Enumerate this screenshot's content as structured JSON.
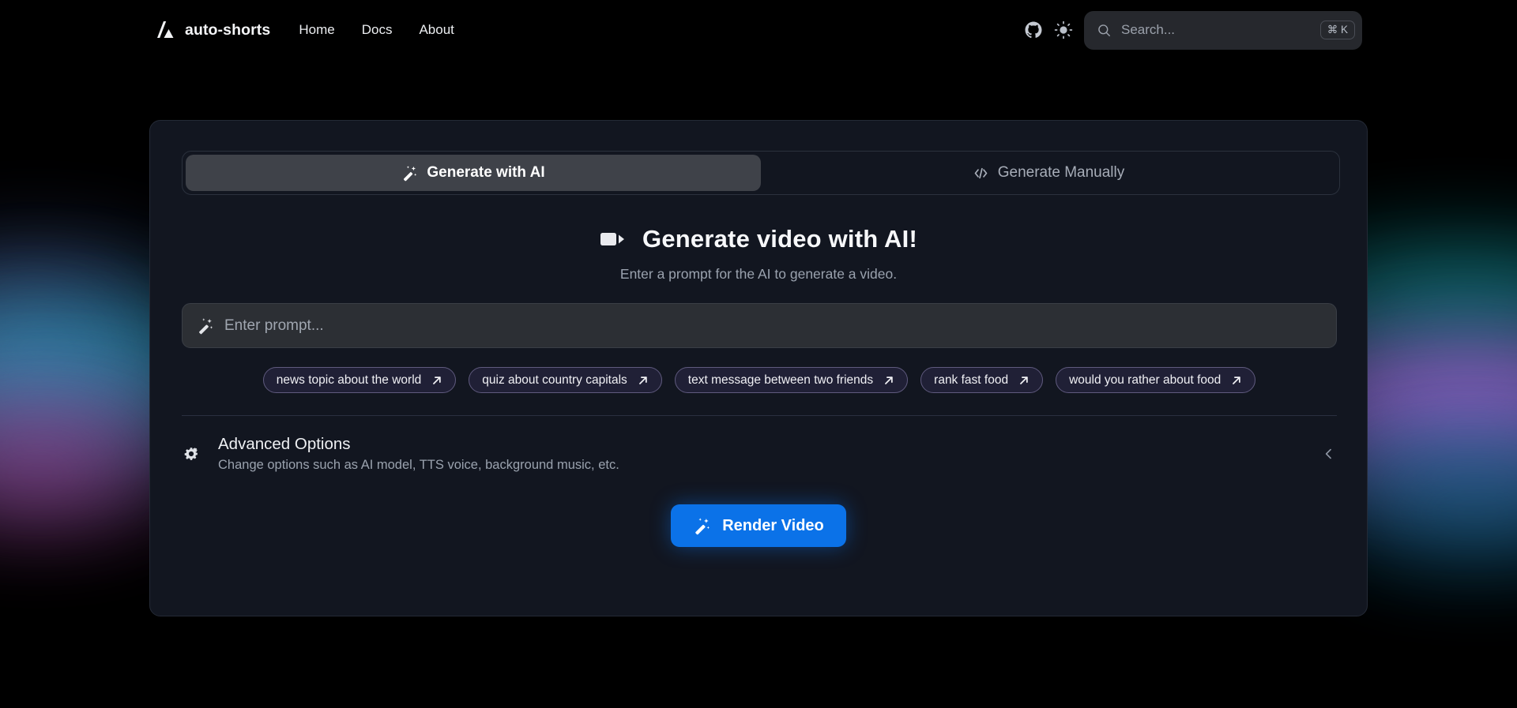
{
  "header": {
    "brand_name": "auto-shorts",
    "logo_icon": "auto-shorts-logo-icon",
    "nav": [
      {
        "label": "Home"
      },
      {
        "label": "Docs"
      },
      {
        "label": "About"
      }
    ],
    "github_icon": "github-icon",
    "theme_icon": "sun-icon",
    "search": {
      "icon": "search-icon",
      "placeholder": "Search...",
      "shortcut": "⌘ K"
    }
  },
  "card": {
    "tabs": [
      {
        "label": "Generate with AI",
        "icon": "magic-wand-icon",
        "active": true
      },
      {
        "label": "Generate Manually",
        "icon": "code-brackets-icon",
        "active": false
      }
    ],
    "heading": {
      "icon": "video-camera-icon",
      "title": "Generate video with AI!",
      "subtitle": "Enter a prompt for the AI to generate a video."
    },
    "prompt": {
      "icon": "magic-wand-icon",
      "placeholder": "Enter prompt...",
      "value": ""
    },
    "suggestions": [
      {
        "label": "news topic about the world",
        "icon": "arrow-up-right-icon"
      },
      {
        "label": "quiz about country capitals",
        "icon": "arrow-up-right-icon"
      },
      {
        "label": "text message between two friends",
        "icon": "arrow-up-right-icon"
      },
      {
        "label": "rank fast food",
        "icon": "arrow-up-right-icon"
      },
      {
        "label": "would you rather about food",
        "icon": "arrow-up-right-icon"
      }
    ],
    "advanced_options": {
      "icon": "cogs-icon",
      "title": "Advanced Options",
      "subtitle": "Change options such as AI model, TTS voice, background music, etc.",
      "toggle_icon": "chevron-left-icon",
      "expanded": false
    },
    "render_button": {
      "label": "Render Video",
      "icon": "magic-wand-icon"
    }
  },
  "colors": {
    "page_background": "#000000",
    "card_background": "#121620",
    "accent_blue": "#0b72e8",
    "active_tab": "#3f4249",
    "input_background": "#2c2f34",
    "muted_text": "#9aa2ae",
    "chip_border": "#5f5a7e"
  }
}
